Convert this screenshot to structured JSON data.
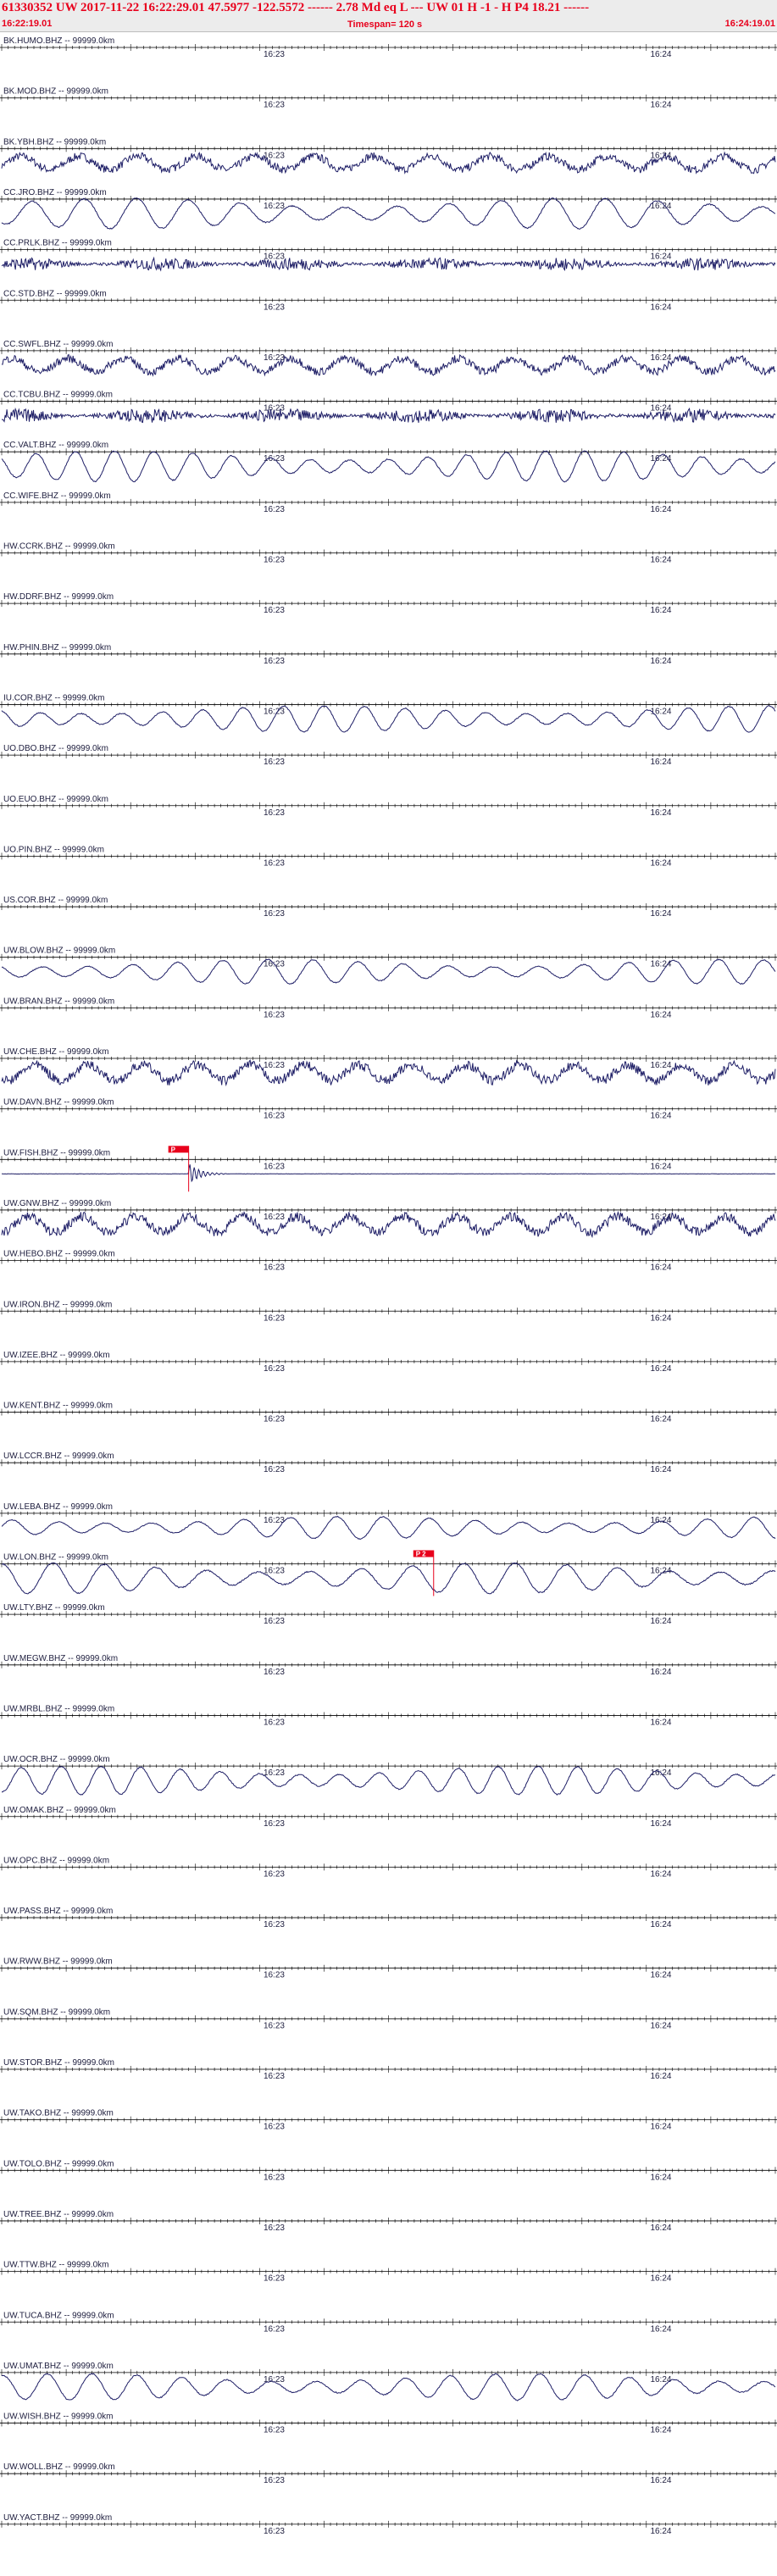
{
  "header": {
    "line1": "61330352 UW 2017-11-22 16:22:29.01   47.5977 -122.5572 ------   2.78 Md  eq  L ---      UW 01  H  -1  -  H P4   18.21 ------",
    "start_time": "16:22:19.01",
    "timespan": "Timespan= 120 s",
    "end_time": "16:24:19.01"
  },
  "colors": {
    "header_text": "#e8001c",
    "header_bg": "#ececec",
    "trace": "#1e1e66",
    "axis": "#000000",
    "pick": "#e8001c"
  },
  "chart_data": {
    "type": "line",
    "title": "61330352 UW 2017-11-22 16:22:29.01",
    "time_window": {
      "start": "16:22:19.01",
      "end": "16:24:19.01",
      "span_s": 120
    },
    "minute_marks": [
      {
        "label": "16:23",
        "t_s": 41
      },
      {
        "label": "16:24",
        "t_s": 101
      }
    ],
    "channels": [
      {
        "label": "BK.HUMO.BHZ -- 99999.0km",
        "amp": 0,
        "kind": "flat"
      },
      {
        "label": "BK.MOD.BHZ -- 99999.0km",
        "amp": 0,
        "kind": "flat"
      },
      {
        "label": "BK.YBH.BHZ -- 99999.0km",
        "amp": 0.55,
        "kind": "mixed"
      },
      {
        "label": "CC.JRO.BHZ -- 99999.0km",
        "amp": 0.75,
        "kind": "smooth"
      },
      {
        "label": "CC.PRLK.BHZ -- 99999.0km",
        "amp": 0.45,
        "kind": "noisy"
      },
      {
        "label": "CC.STD.BHZ -- 99999.0km",
        "amp": 0,
        "kind": "flat"
      },
      {
        "label": "CC.SWFL.BHZ -- 99999.0km",
        "amp": 0.55,
        "kind": "mixed"
      },
      {
        "label": "CC.TCBU.BHZ -- 99999.0km",
        "amp": 0.5,
        "kind": "noisy"
      },
      {
        "label": "CC.VALT.BHZ -- 99999.0km",
        "amp": 0.75,
        "kind": "smooth"
      },
      {
        "label": "CC.WIFE.BHZ -- 99999.0km",
        "amp": 0,
        "kind": "flat"
      },
      {
        "label": "HW.CCRK.BHZ -- 99999.0km",
        "amp": 0,
        "kind": "flat"
      },
      {
        "label": "HW.DDRF.BHZ -- 99999.0km",
        "amp": 0,
        "kind": "flat"
      },
      {
        "label": "HW.PHIN.BHZ -- 99999.0km",
        "amp": 0,
        "kind": "flat"
      },
      {
        "label": "IU.COR.BHZ -- 99999.0km",
        "amp": 0.65,
        "kind": "smooth"
      },
      {
        "label": "UO.DBO.BHZ -- 99999.0km",
        "amp": 0,
        "kind": "flat"
      },
      {
        "label": "UO.EUO.BHZ -- 99999.0km",
        "amp": 0,
        "kind": "flat"
      },
      {
        "label": "UO.PIN.BHZ -- 99999.0km",
        "amp": 0,
        "kind": "flat"
      },
      {
        "label": "US.COR.BHZ -- 99999.0km",
        "amp": 0,
        "kind": "flat"
      },
      {
        "label": "UW.BLOW.BHZ -- 99999.0km",
        "amp": 0.6,
        "kind": "smooth"
      },
      {
        "label": "UW.BRAN.BHZ -- 99999.0km",
        "amp": 0,
        "kind": "flat"
      },
      {
        "label": "UW.CHE.BHZ -- 99999.0km",
        "amp": 0.65,
        "kind": "mixed"
      },
      {
        "label": "UW.DAVN.BHZ -- 99999.0km",
        "amp": 0,
        "kind": "flat"
      },
      {
        "label": "UW.FISH.BHZ -- 99999.0km",
        "amp": 0.06,
        "kind": "event",
        "pick_s": 29,
        "pick_label": "P"
      },
      {
        "label": "UW.GNW.BHZ -- 99999.0km",
        "amp": 0.65,
        "kind": "mixed"
      },
      {
        "label": "UW.HEBO.BHZ -- 99999.0km",
        "amp": 0,
        "kind": "flat"
      },
      {
        "label": "UW.IRON.BHZ -- 99999.0km",
        "amp": 0,
        "kind": "flat"
      },
      {
        "label": "UW.IZEE.BHZ -- 99999.0km",
        "amp": 0,
        "kind": "flat"
      },
      {
        "label": "UW.KENT.BHZ -- 99999.0km",
        "amp": 0,
        "kind": "flat"
      },
      {
        "label": "UW.LCCR.BHZ -- 99999.0km",
        "amp": 0,
        "kind": "flat"
      },
      {
        "label": "UW.LEBA.BHZ -- 99999.0km",
        "amp": 0.55,
        "kind": "smooth"
      },
      {
        "label": "UW.LON.BHZ -- 99999.0km",
        "amp": 0.75,
        "kind": "smooth",
        "pick_s": 67,
        "pick_label": "P 2"
      },
      {
        "label": "UW.LTY.BHZ -- 99999.0km",
        "amp": 0,
        "kind": "flat"
      },
      {
        "label": "UW.MEGW.BHZ -- 99999.0km",
        "amp": 0,
        "kind": "flat"
      },
      {
        "label": "UW.MRBL.BHZ -- 99999.0km",
        "amp": 0,
        "kind": "flat"
      },
      {
        "label": "UW.OCR.BHZ -- 99999.0km",
        "amp": 0.7,
        "kind": "smooth"
      },
      {
        "label": "UW.OMAK.BHZ -- 99999.0km",
        "amp": 0,
        "kind": "flat"
      },
      {
        "label": "UW.OPC.BHZ -- 99999.0km",
        "amp": 0,
        "kind": "flat"
      },
      {
        "label": "UW.PASS.BHZ -- 99999.0km",
        "amp": 0,
        "kind": "flat"
      },
      {
        "label": "UW.RWW.BHZ -- 99999.0km",
        "amp": 0,
        "kind": "flat"
      },
      {
        "label": "UW.SQM.BHZ -- 99999.0km",
        "amp": 0,
        "kind": "flat"
      },
      {
        "label": "UW.STOR.BHZ -- 99999.0km",
        "amp": 0,
        "kind": "flat"
      },
      {
        "label": "UW.TAKO.BHZ -- 99999.0km",
        "amp": 0,
        "kind": "flat"
      },
      {
        "label": "UW.TOLO.BHZ -- 99999.0km",
        "amp": 0,
        "kind": "flat"
      },
      {
        "label": "UW.TREE.BHZ -- 99999.0km",
        "amp": 0,
        "kind": "flat"
      },
      {
        "label": "UW.TTW.BHZ -- 99999.0km",
        "amp": 0,
        "kind": "flat"
      },
      {
        "label": "UW.TUCA.BHZ -- 99999.0km",
        "amp": 0,
        "kind": "flat"
      },
      {
        "label": "UW.UMAT.BHZ -- 99999.0km",
        "amp": 0.65,
        "kind": "smooth"
      },
      {
        "label": "UW.WISH.BHZ -- 99999.0km",
        "amp": 0,
        "kind": "flat"
      },
      {
        "label": "UW.WOLL.BHZ -- 99999.0km",
        "amp": 0,
        "kind": "flat"
      },
      {
        "label": "UW.YACT.BHZ -- 99999.0km",
        "amp": 0,
        "kind": "flat"
      }
    ]
  }
}
